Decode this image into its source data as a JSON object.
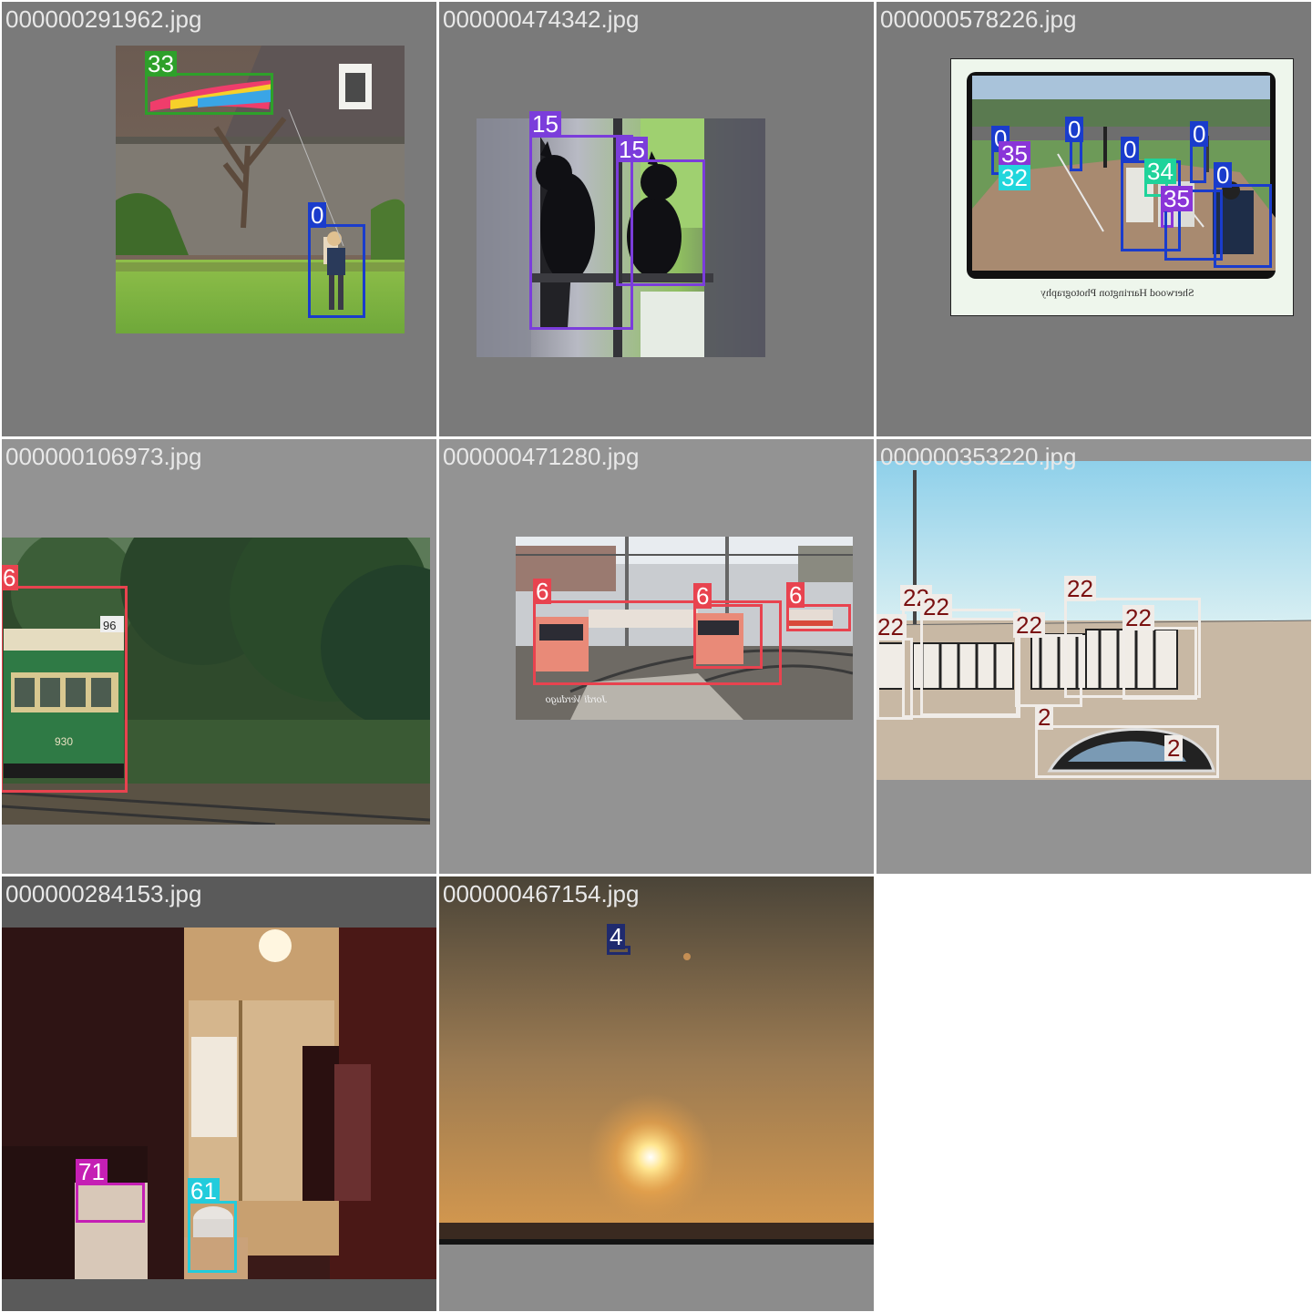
{
  "tiles": [
    {
      "filename": "000000291962.jpg",
      "tile_color": "#7a7a7a",
      "scene": "kite-child-park",
      "detections": [
        {
          "label": "33",
          "color": "#2ea02a",
          "text_color": "#ffffff"
        },
        {
          "label": "0",
          "color": "#1a3ccc",
          "text_color": "#ffffff"
        }
      ]
    },
    {
      "filename": "000000474342.jpg",
      "tile_color": "#7a7a7a",
      "scene": "cats-window-silhouette",
      "detections": [
        {
          "label": "15",
          "color": "#7b3ddb",
          "text_color": "#ffffff"
        },
        {
          "label": "15",
          "color": "#7b3ddb",
          "text_color": "#ffffff"
        }
      ]
    },
    {
      "filename": "000000578226.jpg",
      "tile_color": "#7a7a7a",
      "scene": "baseball-print",
      "print_caption": "Sherwood Harrington Photography",
      "detections": [
        {
          "label": "0",
          "color": "#1a3ccc",
          "text_color": "#ffffff"
        },
        {
          "label": "35",
          "color": "#8a35d8",
          "text_color": "#ffffff"
        },
        {
          "label": "32",
          "color": "#22d6dc",
          "text_color": "#ffffff"
        },
        {
          "label": "0",
          "color": "#1a3ccc",
          "text_color": "#ffffff"
        },
        {
          "label": "0",
          "color": "#1a3ccc",
          "text_color": "#ffffff"
        },
        {
          "label": "34",
          "color": "#1fd39a",
          "text_color": "#ffffff"
        },
        {
          "label": "0",
          "color": "#1a3ccc",
          "text_color": "#ffffff"
        },
        {
          "label": "35",
          "color": "#8a35d8",
          "text_color": "#ffffff"
        },
        {
          "label": "0",
          "color": "#1a3ccc",
          "text_color": "#ffffff"
        }
      ]
    },
    {
      "filename": "000000106973.jpg",
      "tile_color": "#939393",
      "scene": "green-tram-forest",
      "detections": [
        {
          "label": "6",
          "color": "#e8434f",
          "text_color": "#ffffff"
        }
      ]
    },
    {
      "filename": "000000471280.jpg",
      "tile_color": "#939393",
      "scene": "trains-station",
      "detections": [
        {
          "label": "6",
          "color": "#e8434f",
          "text_color": "#ffffff"
        },
        {
          "label": "6",
          "color": "#e8434f",
          "text_color": "#ffffff"
        },
        {
          "label": "6",
          "color": "#e8434f",
          "text_color": "#ffffff"
        }
      ]
    },
    {
      "filename": "000000353220.jpg",
      "tile_color": "#939393",
      "scene": "zebras-mirror",
      "detections": [
        {
          "label": "22",
          "color": "#f0ece8",
          "text_color": "#7a1010"
        },
        {
          "label": "22",
          "color": "#f0ece8",
          "text_color": "#7a1010"
        },
        {
          "label": "22",
          "color": "#f0ece8",
          "text_color": "#7a1010"
        },
        {
          "label": "22",
          "color": "#f0ece8",
          "text_color": "#7a1010"
        },
        {
          "label": "22",
          "color": "#f0ece8",
          "text_color": "#7a1010"
        },
        {
          "label": "22",
          "color": "#f0ece8",
          "text_color": "#7a1010"
        },
        {
          "label": "2",
          "color": "#f0ece8",
          "text_color": "#7a1010"
        },
        {
          "label": "2",
          "color": "#f0ece8",
          "text_color": "#7a1010"
        }
      ]
    },
    {
      "filename": "000000284153.jpg",
      "tile_color": "#5a5a5a",
      "scene": "dark-bathroom",
      "detections": [
        {
          "label": "71",
          "color": "#c51fb4",
          "text_color": "#ffffff"
        },
        {
          "label": "61",
          "color": "#22ccdc",
          "text_color": "#ffffff"
        }
      ]
    },
    {
      "filename": "000000467154.jpg",
      "tile_color": "#8c8c8c",
      "scene": "sunset-sea",
      "detections": [
        {
          "label": "4",
          "color": "#1f2a6e",
          "text_color": "#ffffff"
        }
      ]
    }
  ]
}
